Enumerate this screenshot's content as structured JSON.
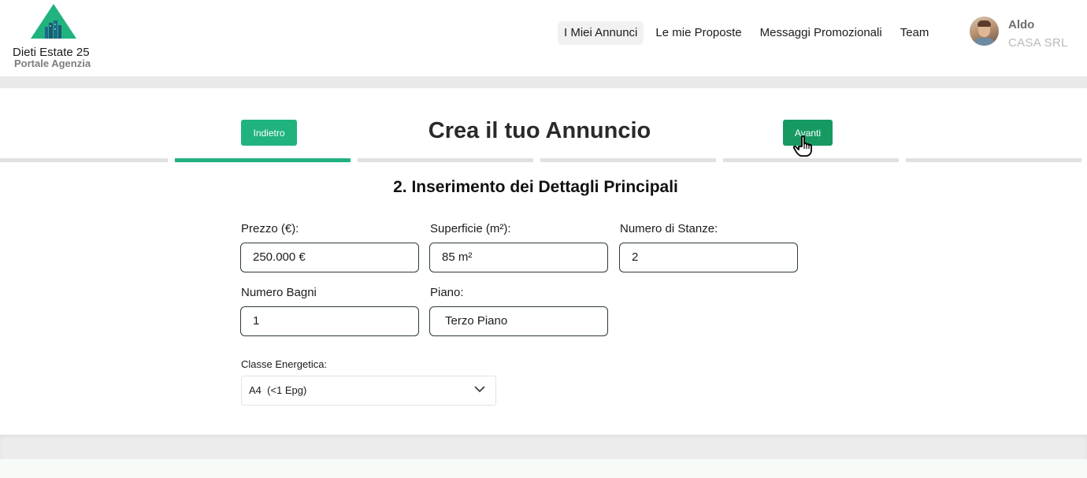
{
  "brand": {
    "name": "Dieti Estate 25",
    "subtitle": "Portale Agenzia"
  },
  "nav": {
    "items": [
      {
        "label": "I Miei Annunci",
        "active": true
      },
      {
        "label": "Le mie Proposte",
        "active": false
      },
      {
        "label": "Messaggi Promozionali",
        "active": false
      },
      {
        "label": "Team",
        "active": false
      }
    ]
  },
  "user": {
    "name": "Aldo",
    "company": "CASA SRL"
  },
  "wizard": {
    "title": "Crea il tuo Annuncio",
    "back_label": "Indietro",
    "next_label": "Avanti",
    "current_step": 2,
    "total_steps": 6
  },
  "section": {
    "title": "2. Inserimento dei Dettagli Principali"
  },
  "form": {
    "price": {
      "label": "Prezzo (€):",
      "value": "250.000 €"
    },
    "area": {
      "label": "Superficie (m²):",
      "value": "85 m²"
    },
    "rooms": {
      "label": "Numero di Stanze:",
      "value": "2"
    },
    "bathrooms": {
      "label": "Numero Bagni",
      "value": "1"
    },
    "floor": {
      "label": "Piano:",
      "value": "Terzo Piano"
    },
    "energy_class": {
      "label": "Classe Energetica:",
      "value": "A4  (<1 Epg)"
    }
  },
  "colors": {
    "accent": "#20b37e",
    "accent_dark": "#169a62",
    "band": "#e9e9e9",
    "step_inactive": "#e1e1e1"
  },
  "icons": {
    "logo": "building-triangle-icon",
    "select": "chevron-down-icon",
    "cursor": "hand-pointer-icon"
  }
}
